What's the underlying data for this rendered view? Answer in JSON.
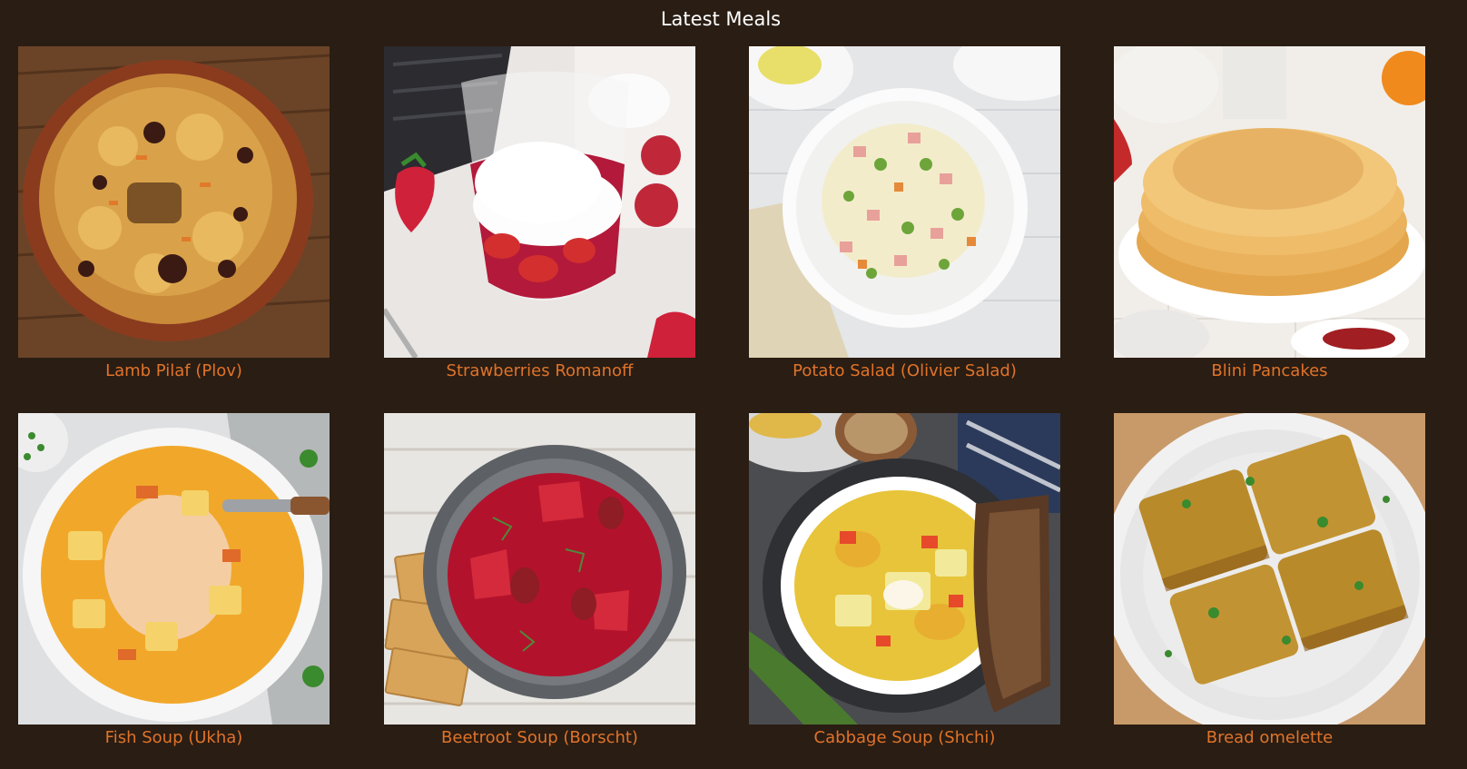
{
  "section": {
    "title": "Latest Meals"
  },
  "meals": [
    {
      "name": "Lamb Pilaf (Plov)"
    },
    {
      "name": "Strawberries Romanoff"
    },
    {
      "name": "Potato Salad (Olivier Salad)"
    },
    {
      "name": "Blini Pancakes"
    },
    {
      "name": "Fish Soup (Ukha)"
    },
    {
      "name": "Beetroot Soup (Borscht)"
    },
    {
      "name": "Cabbage Soup (Shchi)"
    },
    {
      "name": "Bread omelette"
    }
  ]
}
